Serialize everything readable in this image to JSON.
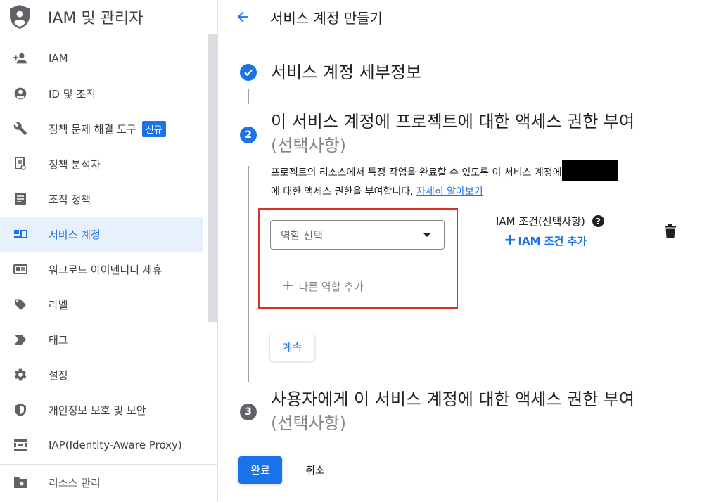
{
  "app": {
    "title": "IAM 및 관리자"
  },
  "sidebar": {
    "items": [
      {
        "label": "IAM",
        "icon": "person-add-icon"
      },
      {
        "label": "ID 및 조직",
        "icon": "account-circle-icon"
      },
      {
        "label": "정책 문제 해결 도구",
        "icon": "wrench-icon",
        "badge": "신규"
      },
      {
        "label": "정책 분석자",
        "icon": "policy-analyzer-icon"
      },
      {
        "label": "조직 정책",
        "icon": "document-icon"
      },
      {
        "label": "서비스 계정",
        "icon": "service-account-icon",
        "active": true
      },
      {
        "label": "워크로드 아이덴티티 제휴",
        "icon": "id-card-icon"
      },
      {
        "label": "라벨",
        "icon": "label-tag-icon"
      },
      {
        "label": "태그",
        "icon": "tag-arrow-icon"
      },
      {
        "label": "설정",
        "icon": "gear-icon"
      },
      {
        "label": "개인정보 보호 및 보안",
        "icon": "shield-icon"
      },
      {
        "label": "IAP(Identity-Aware Proxy)",
        "icon": "iap-icon"
      }
    ],
    "bottom_item": {
      "label": "리소스 관리",
      "icon": "folder-settings-icon"
    }
  },
  "header": {
    "title": "서비스 계정 만들기"
  },
  "steps": {
    "step1": {
      "title": "서비스 계정 세부정보"
    },
    "step2": {
      "number": "2",
      "title": "이 서비스 계정에 프로젝트에 대한 액세스 권한 부여",
      "optional": "(선택사항)",
      "description_part1": "프로젝트의 리소스에서 특정 작업을 완료할 수 있도록 이 서비스 계정에",
      "description_part2": "에 대한 액세스 권한을 부여합니다.",
      "learn_more": "자세히 알아보기",
      "role_placeholder": "역할 선택",
      "add_role": "다른 역할 추가",
      "iam_condition_label": "IAM 조건(선택사항)",
      "add_iam_condition": "IAM 조건 추가",
      "continue_label": "계속"
    },
    "step3": {
      "number": "3",
      "title": "사용자에게 이 서비스 계정에 대한 액세스 권한 부여",
      "optional": "(선택사항)"
    }
  },
  "footer": {
    "done_label": "완료",
    "cancel_label": "취소"
  },
  "colors": {
    "accent": "#1a73e8",
    "highlight_border": "#d93025",
    "step_inactive": "#5f6368"
  }
}
